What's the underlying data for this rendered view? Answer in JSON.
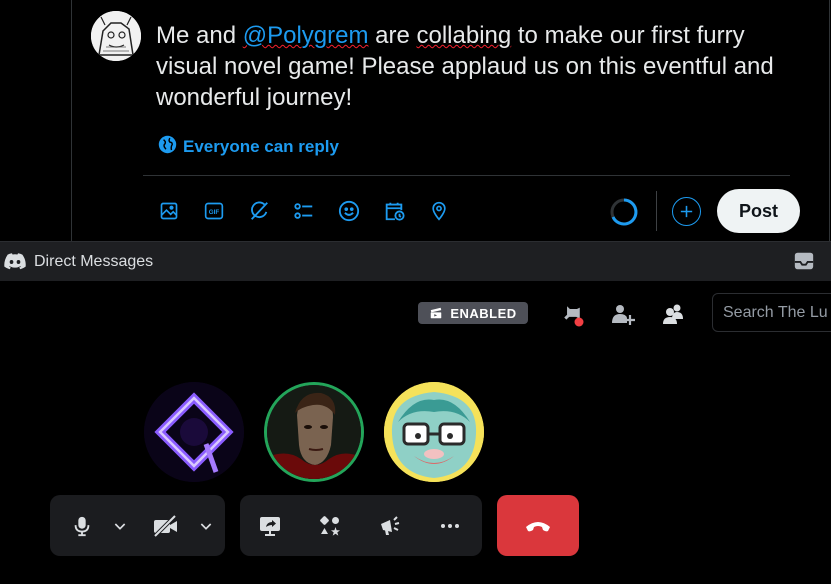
{
  "compose": {
    "text_before": "Me and ",
    "mention": "@Polygrem",
    "text_middle": " are ",
    "misspelled": "collabing",
    "text_after": " to make our first furry visual novel game! Please applaud us on this eventful and wonderful journey!",
    "reply_setting": "Everyone can reply",
    "toolbar": [
      "image-icon",
      "gif-icon",
      "grok-icon",
      "poll-icon",
      "emoji-icon",
      "schedule-icon",
      "location-icon"
    ],
    "post_label": "Post",
    "accent": "#1d9bf0"
  },
  "discord": {
    "window_title": "Direct Messages",
    "badge_label": "ENABLED",
    "search_placeholder": "Search The Lu",
    "hangup_color": "#da373c",
    "speaking_color": "#23a55a"
  }
}
